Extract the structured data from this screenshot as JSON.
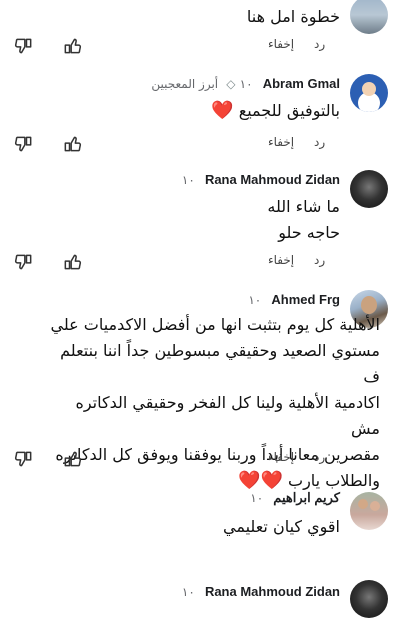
{
  "actions": {
    "reply": "رد",
    "hide": "إخفاء"
  },
  "comments": [
    {
      "text": "خطوة امل هنا"
    },
    {
      "author": "Abram Gmal",
      "badge": "أبرز المعجبين",
      "time": "١٠",
      "text": "بالتوفيق للجميع",
      "emoji": "❤️"
    },
    {
      "author": "Rana Mahmoud Zidan",
      "time": "١٠",
      "text_line1": "ما شاء الله",
      "text_line2": "حاجه حلو"
    },
    {
      "author": "Ahmed Frg",
      "time": "١٠",
      "text_lines": [
        "الأهلية كل يوم بتثبت انها من أفضل الاكدميات علي",
        "مستوي الصعيد وحقيقي مبسوطين جداً اننا بنتعلم ف",
        "اكادمية الأهلية ولينا كل الفخر وحقيقي الدكاتره مش",
        "مقصرين معانا أبداً وربنا يوفقنا ويوفق كل الدكاتره",
        "والطلاب يارب"
      ],
      "emoji": "❤️❤️"
    },
    {
      "author": "كريم ابراهيم",
      "time": "١٠",
      "text": "اقوي كيان تعليمي"
    },
    {
      "author": "Rana Mahmoud Zidan",
      "time": "١٠"
    }
  ]
}
